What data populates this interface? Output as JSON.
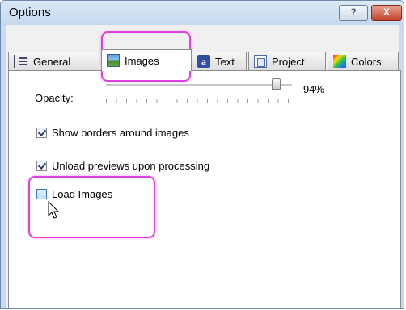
{
  "window": {
    "title": "Options",
    "help_label": "?",
    "close_label": "X"
  },
  "tabs": [
    {
      "label": "General",
      "icon": "general-icon",
      "active": false
    },
    {
      "label": "Images",
      "icon": "images-icon",
      "active": true
    },
    {
      "label": "Text",
      "icon": "text-icon",
      "active": false
    },
    {
      "label": "Project",
      "icon": "project-icon",
      "active": false
    },
    {
      "label": "Colors",
      "icon": "colors-icon",
      "active": false
    }
  ],
  "text_icon_glyph": "a",
  "opacity": {
    "label": "Opacity:",
    "value_text": "94%",
    "value": 94
  },
  "options": [
    {
      "label": "Show borders around images",
      "checked": true
    },
    {
      "label": "Unload previews upon processing",
      "checked": true
    },
    {
      "label": "Load Images",
      "checked": false
    }
  ],
  "highlight_color": "#e040e0"
}
